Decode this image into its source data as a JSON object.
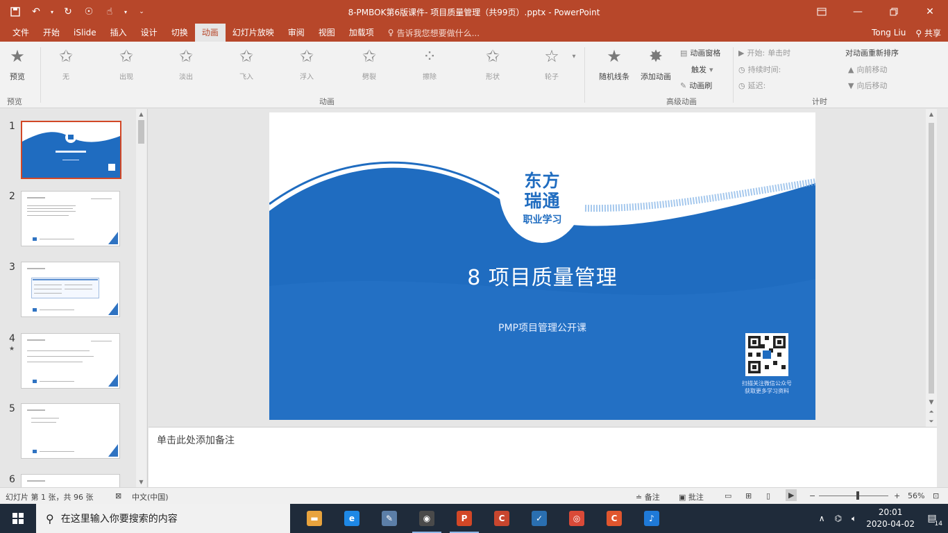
{
  "window": {
    "title": "8-PMBOK第6版课件- 项目质量管理（共99页）.pptx - PowerPoint",
    "qat_icons": [
      "save-icon",
      "undo-icon",
      "redo-icon",
      "touch-mode-icon",
      "hand-icon",
      "customize-icon"
    ],
    "controls": [
      "ribbon-display-icon",
      "minimize-icon",
      "restore-icon",
      "close-icon"
    ]
  },
  "tabs": [
    {
      "label": "文件"
    },
    {
      "label": "开始"
    },
    {
      "label": "iSlide"
    },
    {
      "label": "插入"
    },
    {
      "label": "设计"
    },
    {
      "label": "切换"
    },
    {
      "label": "动画"
    },
    {
      "label": "幻灯片放映"
    },
    {
      "label": "审阅"
    },
    {
      "label": "视图"
    },
    {
      "label": "加载项"
    }
  ],
  "active_tab": "动画",
  "tellme": {
    "placeholder": "告诉我您想要做什么..."
  },
  "user": {
    "name": "Tong Liu",
    "share": "共享"
  },
  "ribbon": {
    "preview_label": "预览",
    "animations": [
      "无",
      "出现",
      "淡出",
      "飞入",
      "浮入",
      "劈裂",
      "擦除",
      "形状",
      "轮子",
      "随机线条"
    ],
    "add_animation": "添加动画",
    "animation_pane": "动画窗格",
    "trigger": "触发",
    "animation_painter": "动画刷",
    "start_label": "开始:",
    "start_value": "单击时",
    "duration_label": "持续时间:",
    "delay_label": "延迟:",
    "reorder_title": "对动画重新排序",
    "move_earlier": "向前移动",
    "move_later": "向后移动",
    "groups": [
      "预览",
      "动画",
      "高级动画",
      "计时"
    ]
  },
  "thumbnails": [
    {
      "num": "1",
      "selected": true
    },
    {
      "num": "2",
      "selected": false
    },
    {
      "num": "3",
      "selected": false
    },
    {
      "num": "4",
      "selected": false,
      "has_animation": true
    },
    {
      "num": "5",
      "selected": false
    },
    {
      "num": "6",
      "selected": false
    }
  ],
  "slide": {
    "logo_line1": "东方",
    "logo_line2": "瑞通",
    "logo_line3": "职业学习",
    "title": "8 项目质量管理",
    "subtitle": "PMP项目管理公开课",
    "qr_caption": "扫描关注微信公众号 获取更多学习资料"
  },
  "notes": {
    "placeholder": "单击此处添加备注"
  },
  "status": {
    "slide_info": "幻灯片 第 1 张，共 96 张",
    "language": "中文(中国)",
    "notes_btn": "备注",
    "comments_btn": "批注",
    "zoom": "56%",
    "zoom_fraction": 0.56
  },
  "taskbar": {
    "search_placeholder": "在这里输入你要搜索的内容",
    "apps": [
      {
        "name": "file-explorer-icon",
        "color": "#e8a33d"
      },
      {
        "name": "edge-icon",
        "color": "#1e88e5"
      },
      {
        "name": "notes-app-icon",
        "color": "#5c7fa8"
      },
      {
        "name": "wechat-icon",
        "color": "#4a4a4a"
      },
      {
        "name": "powerpoint-icon",
        "color": "#d24726"
      },
      {
        "name": "app-c-icon",
        "color": "#c8462e"
      },
      {
        "name": "app-check-icon",
        "color": "#2a6fb0"
      },
      {
        "name": "chrome-icon",
        "color": "#d94a38"
      },
      {
        "name": "app-c2-icon",
        "color": "#e0562e"
      },
      {
        "name": "app-bird-icon",
        "color": "#1f7ad8"
      }
    ],
    "time": "20:01",
    "date": "2020-04-02",
    "notification_count": "14"
  },
  "colors": {
    "accent": "#b7472a",
    "slide_blue": "#1f6cc0",
    "selection": "#d24726"
  }
}
